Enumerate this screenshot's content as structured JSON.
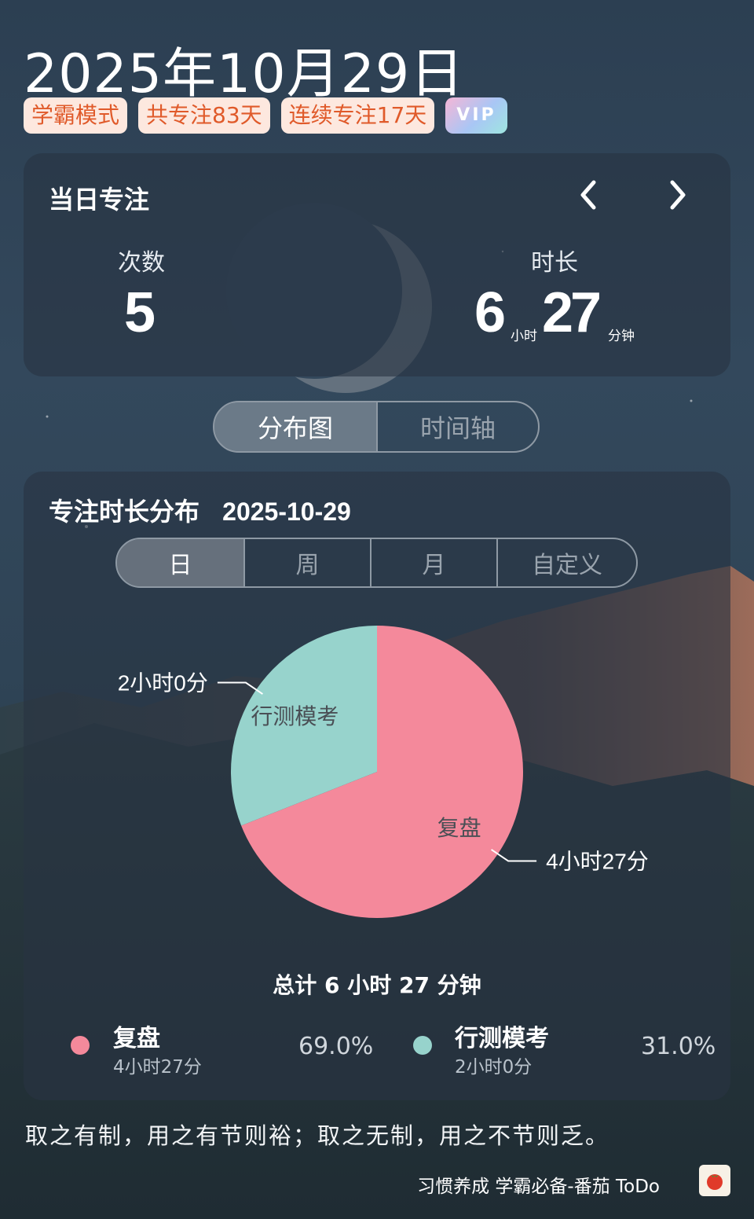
{
  "header": {
    "date": "2025年10月29日",
    "badges": [
      "学霸模式",
      "共专注83天",
      "连续专注17天",
      "VIP"
    ]
  },
  "day_card": {
    "title": "当日专注",
    "count_label": "次数",
    "count_value": "5",
    "duration_label": "时长",
    "hours": "6",
    "hours_unit": "小时",
    "minutes": "27",
    "minutes_unit": "分钟",
    "prev_icon": "chevron-left-icon",
    "next_icon": "chevron-right-icon"
  },
  "view_toggle": {
    "items": [
      "分布图",
      "时间轴"
    ],
    "active": 0
  },
  "chart_card": {
    "title": "专注时长分布",
    "date": "2025-10-29",
    "ranges": [
      "日",
      "周",
      "月",
      "自定义"
    ],
    "active_range": 0,
    "total_text": "总计 6 小时 27 分钟"
  },
  "chart_data": {
    "type": "pie",
    "slices": [
      {
        "name": "复盘",
        "value_minutes": 267,
        "duration_label": "4小时27分",
        "percent": "69.0%",
        "color": "#f4899b"
      },
      {
        "name": "行测模考",
        "value_minutes": 120,
        "duration_label": "2小时0分",
        "percent": "31.0%",
        "color": "#97d3cc"
      }
    ]
  },
  "quote": "取之有制，用之有节则裕；取之无制，用之不节则乏。",
  "footer": {
    "text": "习惯养成 学霸必备-番茄 ToDo",
    "app_icon": "tomato-icon"
  }
}
